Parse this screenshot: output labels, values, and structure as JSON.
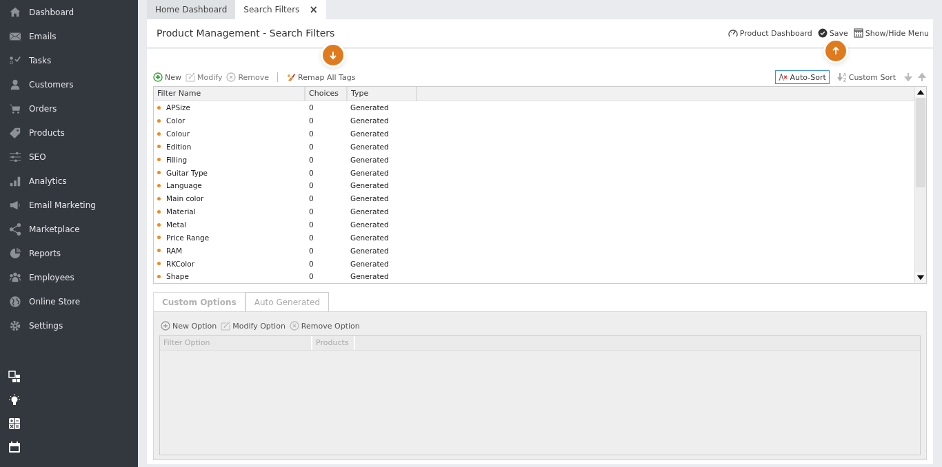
{
  "sidebar": {
    "items": [
      {
        "label": "Dashboard"
      },
      {
        "label": "Emails"
      },
      {
        "label": "Tasks"
      },
      {
        "label": "Customers"
      },
      {
        "label": "Orders"
      },
      {
        "label": "Products"
      },
      {
        "label": "SEO"
      },
      {
        "label": "Analytics"
      },
      {
        "label": "Email Marketing"
      },
      {
        "label": "Marketplace"
      },
      {
        "label": "Reports"
      },
      {
        "label": "Employees"
      },
      {
        "label": "Online Store"
      },
      {
        "label": "Settings"
      }
    ]
  },
  "tabs": [
    {
      "label": "Home Dashboard",
      "selected": false
    },
    {
      "label": "Search Filters",
      "selected": true,
      "close_label": "×"
    }
  ],
  "page": {
    "title": "Product Management - Search Filters",
    "actions": [
      "Product Dashboard",
      "Save",
      "Show/Hide Menu"
    ]
  },
  "toolbar": {
    "left": [
      "New",
      "Modify",
      "Remove",
      "Remap All Tags"
    ],
    "sort": [
      {
        "label": "Auto-Sort",
        "selected": true
      },
      {
        "label": "Custom Sort",
        "selected": false
      }
    ]
  },
  "table": {
    "columns": [
      "Filter Name",
      "Choices",
      "Type"
    ],
    "rows": [
      [
        "APSize",
        "0",
        "Generated"
      ],
      [
        "Color",
        "0",
        "Generated"
      ],
      [
        "Colour",
        "0",
        "Generated"
      ],
      [
        "Edition",
        "0",
        "Generated"
      ],
      [
        "Filling",
        "0",
        "Generated"
      ],
      [
        "Guitar Type",
        "0",
        "Generated"
      ],
      [
        "Language",
        "0",
        "Generated"
      ],
      [
        "Main color",
        "0",
        "Generated"
      ],
      [
        "Material",
        "0",
        "Generated"
      ],
      [
        "Metal",
        "0",
        "Generated"
      ],
      [
        "Price Range",
        "0",
        "Generated"
      ],
      [
        "RAM",
        "0",
        "Generated"
      ],
      [
        "RKColor",
        "0",
        "Generated"
      ],
      [
        "Shape",
        "0",
        "Generated"
      ]
    ]
  },
  "options": {
    "tabs": [
      {
        "label": "Custom Options",
        "selected": true
      },
      {
        "label": "Auto Generated",
        "selected": false
      }
    ],
    "toolbar": [
      "New Option",
      "Modify Option",
      "Remove Option"
    ],
    "columns": [
      "Filter Option",
      "Products"
    ]
  }
}
